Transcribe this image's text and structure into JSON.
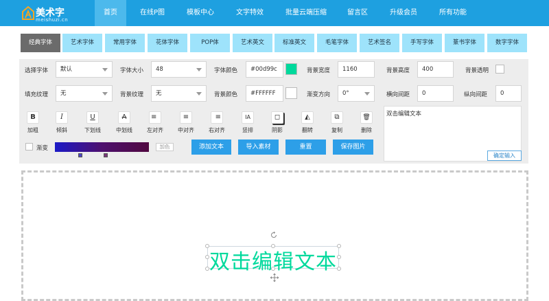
{
  "brand": {
    "title": "美术字",
    "subtitle": "meishuzi.cn"
  },
  "nav": [
    "首页",
    "在线P图",
    "模板中心",
    "文字特效",
    "批量云端压缩",
    "留言区",
    "升级会员",
    "所有功能"
  ],
  "tabs": [
    "经典字体",
    "艺术字体",
    "常用字体",
    "花体字体",
    "POP体",
    "艺术英文",
    "标准英文",
    "毛笔字体",
    "艺术签名",
    "手写字体",
    "篆书字体",
    "数字字体"
  ],
  "settings": {
    "font_select_label": "选择字体",
    "font_select_value": "默认",
    "font_size_label": "字体大小",
    "font_size_value": "48",
    "font_color_label": "字体颜色",
    "font_color_value": "#00d99c",
    "bg_width_label": "背景宽度",
    "bg_width_value": "1160",
    "bg_height_label": "背景高度",
    "bg_height_value": "400",
    "bg_transparent_label": "背景透明",
    "fill_texture_label": "填充纹理",
    "fill_texture_value": "无",
    "bg_texture_label": "背景纹理",
    "bg_texture_value": "无",
    "bg_color_label": "背景颜色",
    "bg_color_value": "#FFFFFF",
    "grad_dir_label": "渐变方向",
    "grad_dir_value": "0°",
    "h_spacing_label": "横向间距",
    "h_spacing_value": "0",
    "v_spacing_label": "纵向间距",
    "v_spacing_value": "0"
  },
  "colors": {
    "font_color": "#00d99c",
    "bg_color": "#FFFFFF",
    "accent": "#1ea0e0"
  },
  "tools": [
    {
      "icon": "B",
      "name": "bold-icon",
      "label": "加粗"
    },
    {
      "icon": "I",
      "name": "italic-icon",
      "label": "倾斜"
    },
    {
      "icon": "U",
      "name": "underline-icon",
      "label": "下划线"
    },
    {
      "icon": "A",
      "name": "strikethrough-icon",
      "label": "中划线"
    },
    {
      "icon": "≡",
      "name": "align-left-icon",
      "label": "左对齐"
    },
    {
      "icon": "≡",
      "name": "align-center-icon",
      "label": "中对齐"
    },
    {
      "icon": "≡",
      "name": "align-right-icon",
      "label": "右对齐"
    },
    {
      "icon": "IA",
      "name": "vertical-text-icon",
      "label": "竖排"
    },
    {
      "icon": "◻",
      "name": "shadow-icon",
      "label": "阴影"
    },
    {
      "icon": "◭",
      "name": "flip-icon",
      "label": "翻转"
    },
    {
      "icon": "⧉",
      "name": "copy-icon",
      "label": "复制"
    },
    {
      "icon": "🗑",
      "name": "trash-icon",
      "label": "删除"
    }
  ],
  "gradient": {
    "label": "渐变",
    "add_color_label": "加色"
  },
  "actions": {
    "add_text": "添加文本",
    "import_material": "导入素材",
    "reset": "重置",
    "save_image": "保存图片"
  },
  "text_input": {
    "value": "双击编辑文本",
    "confirm_label": "确定输入"
  },
  "canvas": {
    "text": "双击编辑文本"
  }
}
